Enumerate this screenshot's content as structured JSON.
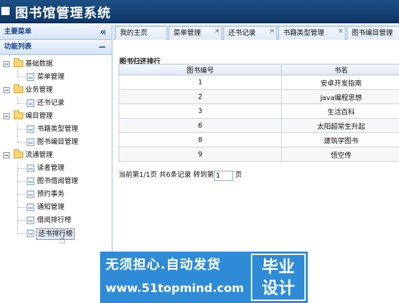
{
  "app": {
    "title": "图书馆管理系统"
  },
  "sidebar": {
    "main_menu_title": "主要菜单",
    "collapse_glyph": "«",
    "func_list_title": "功能列表",
    "func_collapse_glyph": "−",
    "groups": [
      {
        "label": "基础数据",
        "items": [
          "菜单管理"
        ]
      },
      {
        "label": "业务管理",
        "items": [
          "还书记录"
        ]
      },
      {
        "label": "编目管理",
        "items": [
          "书籍类型管理",
          "图书编目管理"
        ]
      },
      {
        "label": "流通管理",
        "items": [
          "读者管理",
          "图书借阅管理",
          "预约事务",
          "通知管理",
          "借阅排行榜",
          "还书排行榜"
        ]
      }
    ],
    "selected_item": "还书排行榜"
  },
  "tabs": [
    {
      "label": "我的主页",
      "closable": false
    },
    {
      "label": "菜单管理",
      "closable": true
    },
    {
      "label": "还书记录",
      "closable": true
    },
    {
      "label": "书籍类型管理",
      "closable": true
    },
    {
      "label": "图书编目管理",
      "closable": false
    }
  ],
  "main": {
    "section_title": "图书归还排行",
    "table": {
      "headers": [
        "图书编号",
        "书名"
      ],
      "rows": [
        [
          "1",
          "安卓开发指南"
        ],
        [
          "2",
          "java编程思想"
        ],
        [
          "3",
          "生活百科"
        ],
        [
          "6",
          "太阳超常生升起"
        ],
        [
          "8",
          "建筑学图书"
        ],
        [
          "9",
          "悟空传"
        ]
      ]
    },
    "pager": {
      "text": "当前第1/1页 共6条记录 转到第",
      "page_value": "1",
      "suffix": "页"
    }
  },
  "watermark": {
    "line1": "无须担心.自动发货",
    "line2": "www.51topmind.com",
    "stamp_line1": "毕业",
    "stamp_line2": "设计"
  },
  "icons": {
    "logo": "window-icon",
    "group": "folder-icon",
    "leaf": "page-icon",
    "toggle": "minus-box-icon",
    "cursor": "hand-pointer-icon"
  },
  "colors": {
    "header": "#0e3766",
    "panel_border": "#99bbe8",
    "watermark": "#2f8bd6"
  }
}
